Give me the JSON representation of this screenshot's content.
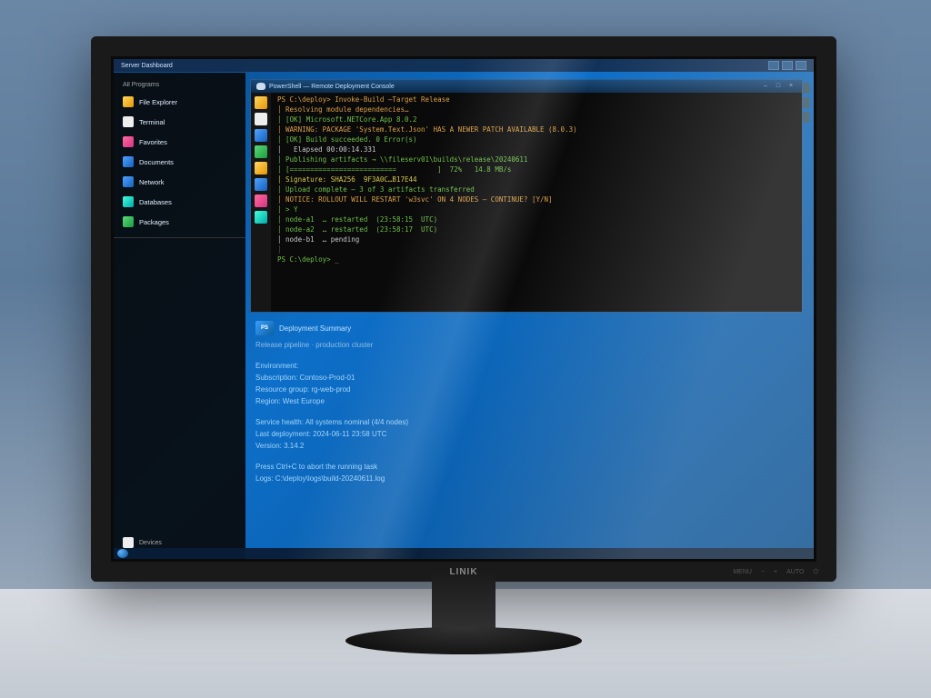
{
  "monitor": {
    "brand": "LINIK",
    "buttons": [
      "MENU",
      "−",
      "+",
      "AUTO",
      "⏻"
    ]
  },
  "topbar": {
    "title": "Server Dashboard"
  },
  "start_menu": {
    "header": "All Programs",
    "items": [
      {
        "label": "File Explorer",
        "icon": "ic-yellow"
      },
      {
        "label": "Terminal",
        "icon": "ic-white"
      },
      {
        "label": "Favorites",
        "icon": "ic-pink"
      },
      {
        "label": "Documents",
        "icon": "ic-blue"
      },
      {
        "label": "Network",
        "icon": "ic-blue"
      },
      {
        "label": "Databases",
        "icon": "ic-teal"
      },
      {
        "label": "Packages",
        "icon": "ic-green"
      }
    ],
    "footer": "Devices"
  },
  "terminal": {
    "title": "PowerShell — Remote Deployment Console",
    "side_icons": [
      "ic-yellow",
      "ic-white",
      "ic-blue",
      "ic-green",
      "ic-yellow",
      "ic-blue",
      "ic-pink",
      "ic-teal"
    ],
    "lines": [
      {
        "cls": "c-o",
        "txt": "PS C:\\deploy> Invoke-Build –Target Release"
      },
      {
        "cls": "c-o",
        "txt": "│ Resolving module dependencies…"
      },
      {
        "cls": "c-g",
        "txt": "│ [OK] Microsoft.NETCore.App 8.0.2"
      },
      {
        "cls": "c-o",
        "txt": "│ WARNING: PACKAGE 'System.Text.Json' HAS A NEWER PATCH AVAILABLE (8.0.3)"
      },
      {
        "cls": "c-g",
        "txt": "│ [OK] Build succeeded. 0 Error(s)"
      },
      {
        "cls": "c-w",
        "txt": "│   Elapsed 00:00:14.331"
      },
      {
        "cls": "c-g",
        "txt": "│ Publishing artifacts → \\\\fileserv01\\builds\\release\\20240611"
      },
      {
        "cls": "c-g",
        "txt": "│ [==========================          ]  72%   14.8 MB/s"
      },
      {
        "cls": "c-y",
        "txt": "│ Signature: SHA256  9F3A0C…B17E44"
      },
      {
        "cls": "c-g",
        "txt": "│ Upload complete — 3 of 3 artifacts transferred"
      },
      {
        "cls": "c-o",
        "txt": "│ NOTICE: ROLLOUT WILL RESTART 'w3svc' ON 4 NODES — CONTINUE? [Y/N]"
      },
      {
        "cls": "c-g",
        "txt": "│ > Y"
      },
      {
        "cls": "c-g",
        "txt": "│ node-a1  … restarted  (23:58:15  UTC)"
      },
      {
        "cls": "c-g",
        "txt": "│ node-a2  … restarted  (23:58:17  UTC)"
      },
      {
        "cls": "c-w",
        "txt": "│ node-b1  … pending"
      },
      {
        "cls": "c-dim",
        "txt": "│"
      },
      {
        "cls": "c-g",
        "txt": "PS C:\\deploy> _"
      }
    ]
  },
  "info": {
    "badge": "PS",
    "heading": "Deployment Summary",
    "subheading": "Release pipeline · production cluster",
    "block1": [
      "Environment:",
      "Subscription: Contoso-Prod-01",
      "Resource group: rg-web-prod",
      "Region: West Europe"
    ],
    "block2": [
      "Service health: All systems nominal (4/4 nodes)",
      "Last deployment: 2024-06-11 23:58 UTC",
      "Version: 3.14.2"
    ],
    "block3": [
      "Press Ctrl+C to abort the running task",
      "Logs: C:\\deploy\\logs\\build-20240611.log"
    ]
  }
}
